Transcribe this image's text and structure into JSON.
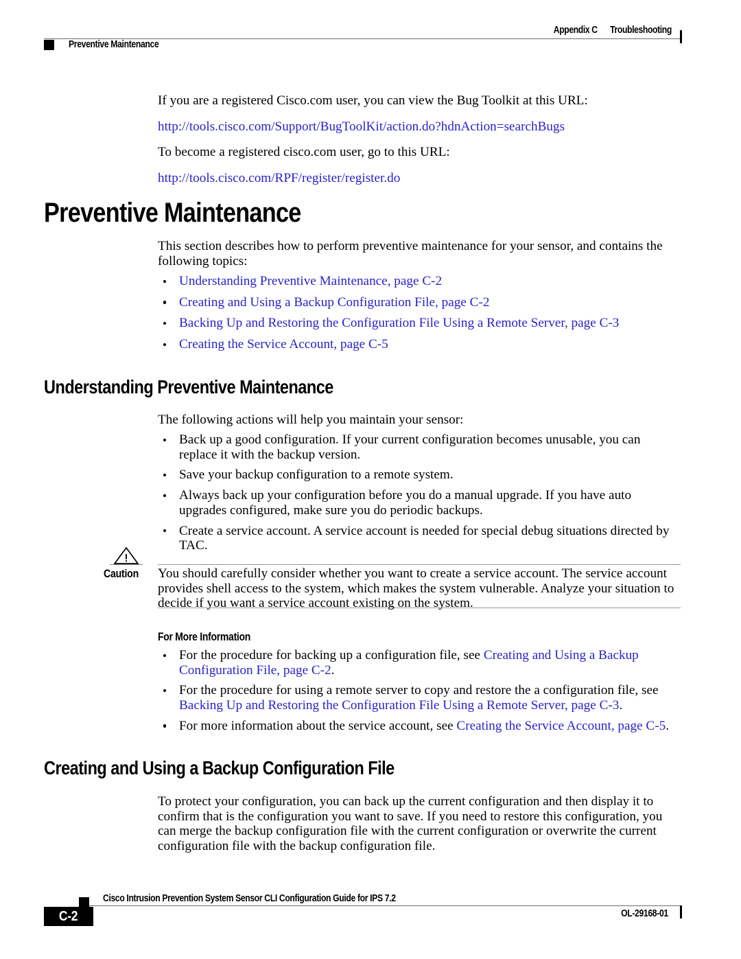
{
  "header": {
    "appendix_label": "Appendix C",
    "chapter_title": "Troubleshooting",
    "running_head": "Preventive Maintenance"
  },
  "intro": {
    "line1": "If you are a registered Cisco.com user, you can view the Bug Toolkit at this URL:",
    "url1": "http://tools.cisco.com/Support/BugToolKit/action.do?hdnAction=searchBugs",
    "line2": "To become a registered cisco.com user, go to this URL:",
    "url2": "http://tools.cisco.com/RPF/register/register.do"
  },
  "section_main": {
    "heading": "Preventive Maintenance",
    "intro": "This section describes how to perform preventive maintenance for your sensor, and contains the following topics:",
    "topics": [
      "Understanding Preventive Maintenance, page C-2",
      "Creating and Using a Backup Configuration File, page C-2",
      "Backing Up and Restoring the Configuration File Using a Remote Server, page C-3",
      "Creating the Service Account, page C-5"
    ]
  },
  "section_understanding": {
    "heading": "Understanding Preventive Maintenance",
    "intro": "The following actions will help you maintain your sensor:",
    "actions": [
      "Back up a good configuration. If your current configuration becomes unusable, you can replace it with the backup version.",
      "Save your backup configuration to a remote system.",
      "Always back up your configuration before you do a manual upgrade. If you have auto upgrades configured, make sure you do periodic backups.",
      "Create a service account. A service account is needed for special debug situations directed by TAC."
    ]
  },
  "caution": {
    "icon": "warning-triangle-icon",
    "label": "Caution",
    "text": "You should carefully consider whether you want to create a service account. The service account provides shell access to the system, which makes the system vulnerable. Analyze your situation to decide if you want a service account existing on the system."
  },
  "for_more_information": {
    "heading": "For More Information",
    "items": [
      {
        "pre": "For the procedure for backing up a configuration file, see ",
        "link": "Creating and Using a Backup Configuration File, page C-2",
        "post": "."
      },
      {
        "pre": "For the procedure for using a remote server to copy and restore the a configuration file, see ",
        "link": "Backing Up and Restoring the Configuration File Using a Remote Server, page C-3",
        "post": "."
      },
      {
        "pre": "For more information about the service account, see ",
        "link": "Creating the Service Account, page C-5",
        "post": "."
      }
    ]
  },
  "section_backup": {
    "heading": "Creating and Using a Backup Configuration File",
    "paragraph": "To protect your configuration, you can back up the current configuration and then display it to confirm that is the configuration you want to save. If you need to restore this configuration, you can merge the backup configuration file with the current configuration or overwrite the current configuration file with the backup configuration file."
  },
  "footer": {
    "page_number": "C-2",
    "guide_title": "Cisco Intrusion Prevention System Sensor CLI Configuration Guide for IPS 7.2",
    "doc_id": "OL-29168-01"
  },
  "colors": {
    "link": "#2a22cc",
    "rule": "#6d6d6d",
    "text": "#000000"
  }
}
